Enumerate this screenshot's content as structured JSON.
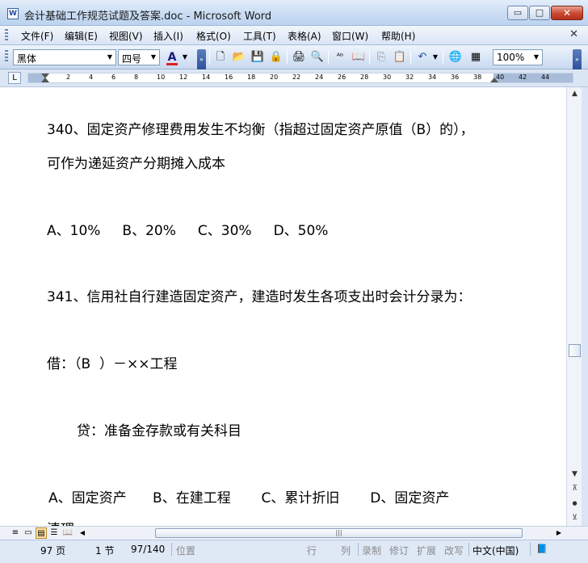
{
  "window": {
    "title": "会计基础工作规范试题及答案.doc - Microsoft Word",
    "app_icon": "W",
    "minimize_glyph": "▭",
    "maximize_glyph": "□",
    "close_glyph": "✕"
  },
  "menu": {
    "items": [
      "文件(F)",
      "编辑(E)",
      "视图(V)",
      "插入(I)",
      "格式(O)",
      "工具(T)",
      "表格(A)",
      "窗口(W)",
      "帮助(H)"
    ],
    "doc_close_glyph": "✕"
  },
  "toolbar": {
    "font_name": "黑体",
    "font_size": "四号",
    "zoom": "100%",
    "font_color_label": "A",
    "dropdown_glyph": "▼",
    "overflow_glyph": "»",
    "icons": [
      "new-document-icon",
      "open-folder-icon",
      "save-icon",
      "permission-icon",
      "print-icon",
      "print-preview-icon",
      "spelling-icon",
      "research-icon",
      "copy-icon",
      "paste-icon",
      "undo-icon",
      "hyperlink-icon",
      "table-icon"
    ],
    "glyphs": {
      "new": "🗋",
      "open": "📂",
      "save": "💾",
      "permission": "🔒",
      "print": "🖨",
      "preview": "🔍",
      "spelling": "ᴬᵇ",
      "research": "📖",
      "copy": "⎘",
      "paste": "📋",
      "undo": "↶",
      "hyperlink": "🌐",
      "table": "▦"
    },
    "font_color_accent": "#e02020"
  },
  "ruler": {
    "corner_glyph": "L",
    "ticks": [
      "2",
      "4",
      "6",
      "8",
      "10",
      "12",
      "14",
      "16",
      "18",
      "20",
      "22",
      "24",
      "26",
      "28",
      "30",
      "32",
      "34",
      "36",
      "38",
      "40",
      "42",
      "44"
    ]
  },
  "document": {
    "paragraphs": [
      "340、固定资产修理费用发生不均衡（指超过固定资产原值（B）的），",
      "可作为递延资产分期摊入成本",
      "A、10%     B、20%     C、30%     D、50%",
      "341、信用社自行建造固定资产，建造时发生各项支出时会计分录为：",
      "借：（B  ）－××工程",
      "贷：准备金存款或有关科目",
      "A、固定资产      B、在建工程       C、累计折旧       D、固定资产",
      "清理"
    ]
  },
  "scrollbar": {
    "up_glyph": "▲",
    "down_glyph": "▼",
    "prev_page_glyph": "⊼",
    "select_browse_glyph": "●",
    "next_page_glyph": "⊻",
    "left_glyph": "◀",
    "right_glyph": "▶",
    "thumb_grip": "|||"
  },
  "status": {
    "page": "97 页",
    "section": "1 节",
    "page_of": "97/140",
    "position": "位置",
    "line": "行",
    "column": "列",
    "record": "录制",
    "revise": "修订",
    "extend": "扩展",
    "overtype": "改写",
    "language": "中文(中国)"
  }
}
